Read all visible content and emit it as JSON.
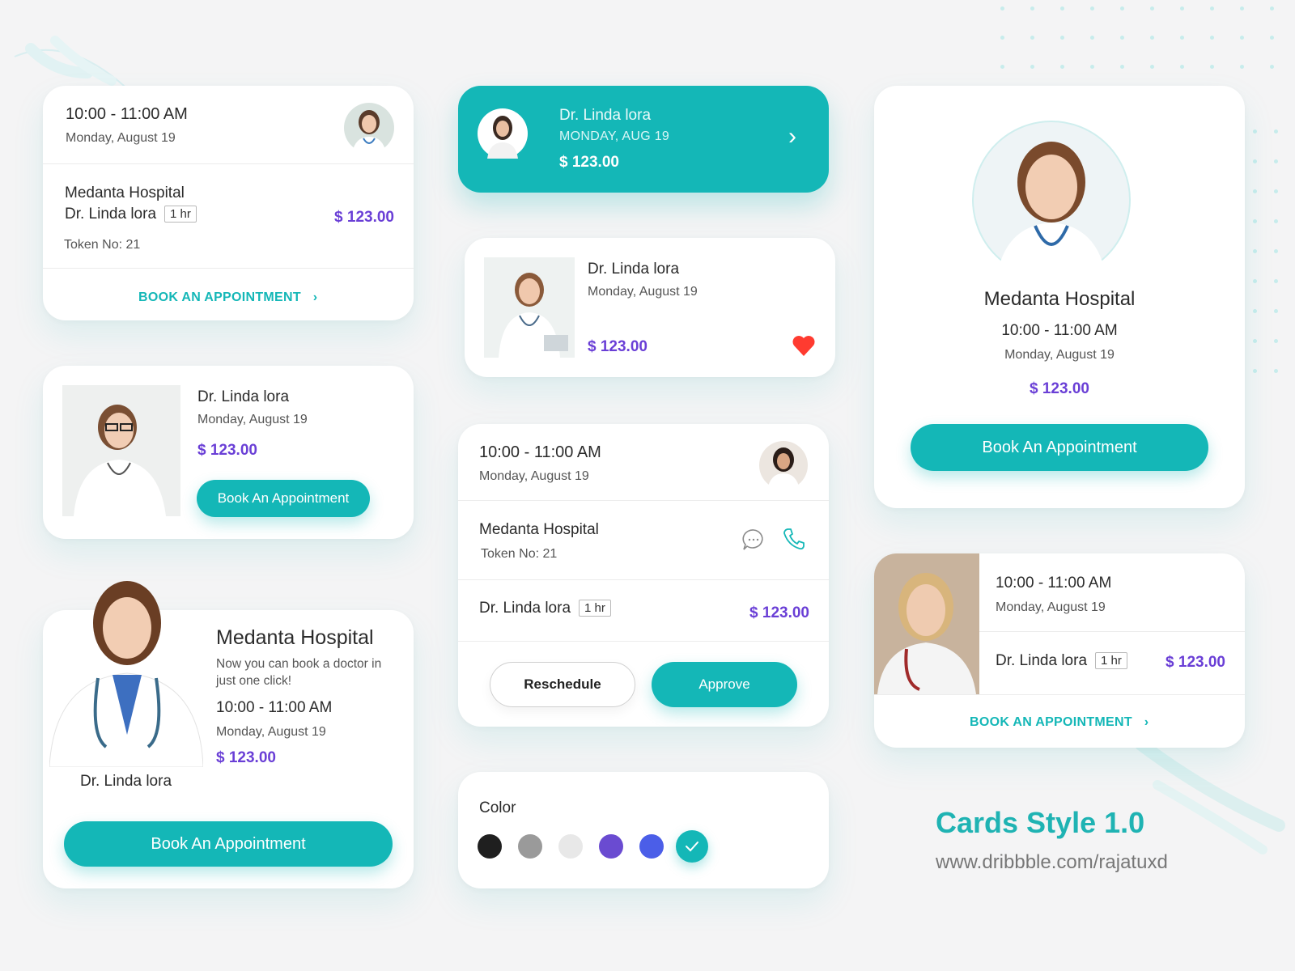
{
  "colors": {
    "accent": "#14b7b7",
    "price": "#6a3fd6",
    "heart": "#ff3b30"
  },
  "card1": {
    "time": "10:00 - 11:00 AM",
    "date": "Monday, August 19",
    "hospital": "Medanta Hospital",
    "doctor": "Dr. Linda lora",
    "duration": "1 hr",
    "price": "$ 123.00",
    "token": "Token No: 21",
    "cta": "BOOK AN APPOINTMENT"
  },
  "card2": {
    "doctor": "Dr. Linda lora",
    "date": "MONDAY, AUG 19",
    "price": "$ 123.00"
  },
  "card3": {
    "doctor": "Dr. Linda lora",
    "date": "Monday, August 19",
    "price": "$ 123.00"
  },
  "card4": {
    "hospital": "Medanta Hospital",
    "time": "10:00 - 11:00 AM",
    "date": "Monday, August 19",
    "price": "$ 123.00",
    "cta": "Book An Appointment"
  },
  "card5": {
    "doctor": "Dr. Linda lora",
    "date": "Monday, August 19",
    "price": "$ 123.00",
    "cta": "Book An Appointment"
  },
  "card6": {
    "time": "10:00 - 11:00 AM",
    "date": "Monday, August 19",
    "hospital": "Medanta Hospital",
    "token": "Token No: 21",
    "doctor": "Dr. Linda lora",
    "duration": "1 hr",
    "price": "$ 123.00",
    "reschedule": "Reschedule",
    "approve": "Approve"
  },
  "card7": {
    "hospital": "Medanta Hospital",
    "tagline": "Now you can book a doctor in just one click!",
    "time": "10:00 - 11:00 AM",
    "date": "Monday, August 19",
    "price": "$ 123.00",
    "doctor": "Dr. Linda lora",
    "cta": "Book An Appointment"
  },
  "card8": {
    "time": "10:00 - 11:00 AM",
    "date": "Monday, August 19",
    "doctor": "Dr. Linda lora",
    "duration": "1 hr",
    "price": "$ 123.00",
    "cta": "BOOK AN APPOINTMENT"
  },
  "color_picker": {
    "label": "Color",
    "swatches": [
      "#1f1f1f",
      "#9a9a9a",
      "#e8e8e8",
      "#6a4bd1",
      "#4b5ee8",
      "#14b7b7"
    ],
    "selected_index": 5
  },
  "branding": {
    "title": "Cards Style 1.0",
    "url": "www.dribbble.com/rajatuxd"
  }
}
